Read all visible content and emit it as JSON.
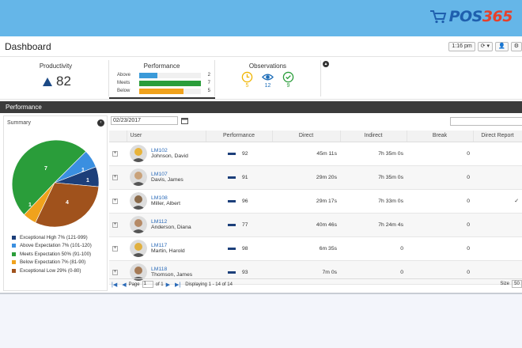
{
  "brand": {
    "text": "POS",
    "num": "365"
  },
  "header": {
    "title": "Dashboard",
    "time": "1:16 pm"
  },
  "kpis": {
    "productivity": {
      "title": "Productivity",
      "value": "82"
    },
    "performance": {
      "title": "Performance",
      "rows": [
        {
          "label": "Above",
          "count": "2",
          "fraction": 0.29,
          "color": "#3a9ad9"
        },
        {
          "label": "Meets",
          "count": "7",
          "fraction": 1.0,
          "color": "#2a9d3a"
        },
        {
          "label": "Below",
          "count": "5",
          "fraction": 0.72,
          "color": "#f0a21c"
        }
      ]
    },
    "observations": {
      "title": "Observations",
      "items": [
        {
          "icon": "clock-icon",
          "value": "5",
          "color": "#f0b400"
        },
        {
          "icon": "eye-icon",
          "value": "12",
          "color": "#1d6db8"
        },
        {
          "icon": "check-circle-icon",
          "value": "9",
          "color": "#2a9d3a"
        }
      ]
    }
  },
  "section": {
    "title": "Performance"
  },
  "summary": {
    "label": "Summary",
    "legend": [
      {
        "label": "Exceptional High 7% (121-999)",
        "color": "#1c3f7a"
      },
      {
        "label": "Above Expectation 7% (101-120)",
        "color": "#3a8fe0"
      },
      {
        "label": "Meets Expectation 50% (91-100)",
        "color": "#2a9d3a"
      },
      {
        "label": "Below Expectation 7% (81-90)",
        "color": "#f0a21c"
      },
      {
        "label": "Exceptional Low 29% (0-80)",
        "color": "#a0521c"
      }
    ],
    "pie_labels": [
      "7",
      "1",
      "1",
      "1",
      "4"
    ]
  },
  "filter": {
    "date": "02/23/2017"
  },
  "table": {
    "headers": [
      "User",
      "Performance",
      "Direct",
      "Indirect",
      "Break",
      "Direct Report"
    ],
    "rows": [
      {
        "id": "LM102",
        "name": "Johnson, David",
        "perf": "92",
        "direct": "45m 11s",
        "indirect": "7h 35m 0s",
        "brk": "0",
        "report": ""
      },
      {
        "id": "LM107",
        "name": "Davis, James",
        "perf": "91",
        "direct": "29m 20s",
        "indirect": "7h 35m 0s",
        "brk": "0",
        "report": ""
      },
      {
        "id": "LM108",
        "name": "Miller, Albert",
        "perf": "96",
        "direct": "29m 17s",
        "indirect": "7h 33m 0s",
        "brk": "0",
        "report": "✓"
      },
      {
        "id": "LM112",
        "name": "Anderson, Diana",
        "perf": "77",
        "direct": "40m 46s",
        "indirect": "7h 24m 4s",
        "brk": "0",
        "report": ""
      },
      {
        "id": "LM117",
        "name": "Martin, Harold",
        "perf": "98",
        "direct": "6m 35s",
        "indirect": "0",
        "brk": "0",
        "report": ""
      },
      {
        "id": "LM118",
        "name": "Thomson, James",
        "perf": "93",
        "direct": "7m 0s",
        "indirect": "0",
        "brk": "0",
        "report": ""
      }
    ]
  },
  "pager": {
    "page_label": "Page",
    "page": "1",
    "of": "of 1",
    "displaying": "Displaying 1 - 14 of 14",
    "size_label": "Size",
    "size": "50"
  }
}
